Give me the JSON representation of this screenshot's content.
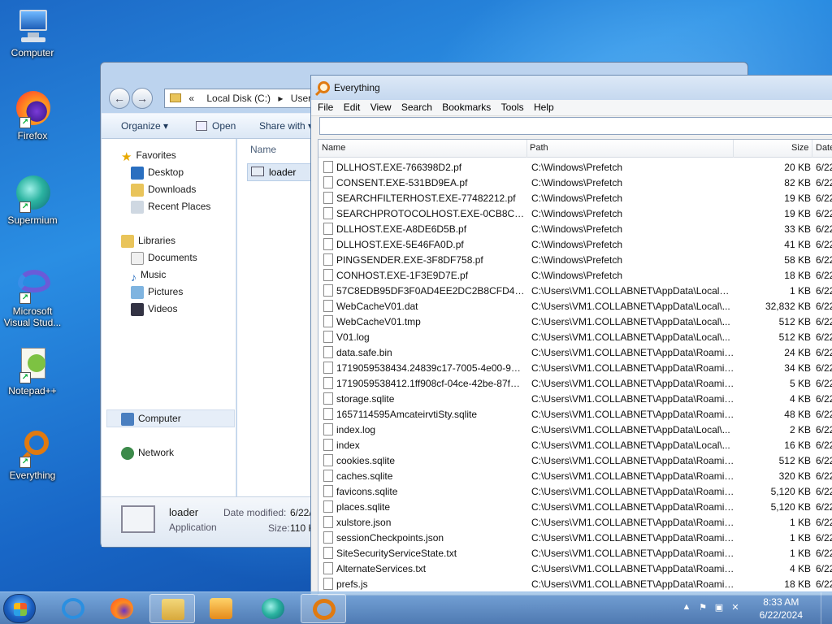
{
  "desktop": {
    "icons": [
      {
        "label": "Computer",
        "icon": "computer-icon"
      },
      {
        "label": "Firefox",
        "icon": "firefox-icon"
      },
      {
        "label": "Supermium",
        "icon": "supermium-icon"
      },
      {
        "label": "Microsoft Visual Studio...",
        "label_line1": "Microsoft",
        "label_line2": "Visual Stud...",
        "icon": "visual-studio-icon"
      },
      {
        "label": "Notepad++",
        "icon": "notepad-plus-plus-icon"
      },
      {
        "label": "Everything",
        "icon": "everything-icon"
      }
    ]
  },
  "explorer": {
    "breadcrumb": [
      "«",
      "Local Disk (C:)",
      "Users"
    ],
    "toolbar": {
      "organize": "Organize ▾",
      "open": "Open",
      "share_with": "Share with ▾"
    },
    "nav": {
      "favorites": "Favorites",
      "desktop": "Desktop",
      "downloads": "Downloads",
      "recent_places": "Recent Places",
      "libraries": "Libraries",
      "documents": "Documents",
      "music": "Music",
      "pictures": "Pictures",
      "videos": "Videos",
      "computer": "Computer",
      "network": "Network"
    },
    "content": {
      "column_name": "Name",
      "file_name": "loader"
    },
    "details": {
      "name": "loader",
      "type": "Application",
      "date_modified_label": "Date modified:",
      "date_modified_value": "6/22/",
      "size_label": "Size:",
      "size_value": "110 K"
    }
  },
  "everything": {
    "title": "Everything",
    "menu": [
      "File",
      "Edit",
      "View",
      "Search",
      "Bookmarks",
      "Tools",
      "Help"
    ],
    "search_value": "",
    "columns": {
      "name": "Name",
      "path": "Path",
      "size": "Size",
      "date": "Date"
    },
    "rows": [
      {
        "name": "DLLHOST.EXE-766398D2.pf",
        "path": "C:\\Windows\\Prefetch",
        "size": "20 KB",
        "date": "6/22"
      },
      {
        "name": "CONSENT.EXE-531BD9EA.pf",
        "path": "C:\\Windows\\Prefetch",
        "size": "82 KB",
        "date": "6/22"
      },
      {
        "name": "SEARCHFILTERHOST.EXE-77482212.pf",
        "path": "C:\\Windows\\Prefetch",
        "size": "19 KB",
        "date": "6/22"
      },
      {
        "name": "SEARCHPROTOCOLHOST.EXE-0CB8CADE...",
        "path": "C:\\Windows\\Prefetch",
        "size": "19 KB",
        "date": "6/22"
      },
      {
        "name": "DLLHOST.EXE-A8DE6D5B.pf",
        "path": "C:\\Windows\\Prefetch",
        "size": "33 KB",
        "date": "6/22"
      },
      {
        "name": "DLLHOST.EXE-5E46FA0D.pf",
        "path": "C:\\Windows\\Prefetch",
        "size": "41 KB",
        "date": "6/22"
      },
      {
        "name": "PINGSENDER.EXE-3F8DF758.pf",
        "path": "C:\\Windows\\Prefetch",
        "size": "58 KB",
        "date": "6/22"
      },
      {
        "name": "CONHOST.EXE-1F3E9D7E.pf",
        "path": "C:\\Windows\\Prefetch",
        "size": "18 KB",
        "date": "6/22"
      },
      {
        "name": "57C8EDB95DF3F0AD4EE2DC2B8CFD4157",
        "path": "C:\\Users\\VM1.COLLABNET\\AppData\\LocalLo...",
        "size": "1 KB",
        "date": "6/22"
      },
      {
        "name": "WebCacheV01.dat",
        "path": "C:\\Users\\VM1.COLLABNET\\AppData\\Local\\...",
        "size": "32,832 KB",
        "date": "6/22"
      },
      {
        "name": "WebCacheV01.tmp",
        "path": "C:\\Users\\VM1.COLLABNET\\AppData\\Local\\...",
        "size": "512 KB",
        "date": "6/22"
      },
      {
        "name": "V01.log",
        "path": "C:\\Users\\VM1.COLLABNET\\AppData\\Local\\...",
        "size": "512 KB",
        "date": "6/22"
      },
      {
        "name": "data.safe.bin",
        "path": "C:\\Users\\VM1.COLLABNET\\AppData\\Roamin...",
        "size": "24 KB",
        "date": "6/22"
      },
      {
        "name": "1719059538434.24839c17-7005-4e00-9185-...",
        "path": "C:\\Users\\VM1.COLLABNET\\AppData\\Roamin...",
        "size": "34 KB",
        "date": "6/22"
      },
      {
        "name": "1719059538412.1ff908cf-04ce-42be-87f4-3...",
        "path": "C:\\Users\\VM1.COLLABNET\\AppData\\Roamin...",
        "size": "5 KB",
        "date": "6/22"
      },
      {
        "name": "storage.sqlite",
        "path": "C:\\Users\\VM1.COLLABNET\\AppData\\Roamin...",
        "size": "4 KB",
        "date": "6/22"
      },
      {
        "name": "1657114595AmcateirvtiSty.sqlite",
        "path": "C:\\Users\\VM1.COLLABNET\\AppData\\Roamin...",
        "size": "48 KB",
        "date": "6/22"
      },
      {
        "name": "index.log",
        "path": "C:\\Users\\VM1.COLLABNET\\AppData\\Local\\...",
        "size": "2 KB",
        "date": "6/22"
      },
      {
        "name": "index",
        "path": "C:\\Users\\VM1.COLLABNET\\AppData\\Local\\...",
        "size": "16 KB",
        "date": "6/22"
      },
      {
        "name": "cookies.sqlite",
        "path": "C:\\Users\\VM1.COLLABNET\\AppData\\Roamin...",
        "size": "512 KB",
        "date": "6/22"
      },
      {
        "name": "caches.sqlite",
        "path": "C:\\Users\\VM1.COLLABNET\\AppData\\Roamin...",
        "size": "320 KB",
        "date": "6/22"
      },
      {
        "name": "favicons.sqlite",
        "path": "C:\\Users\\VM1.COLLABNET\\AppData\\Roamin...",
        "size": "5,120 KB",
        "date": "6/22"
      },
      {
        "name": "places.sqlite",
        "path": "C:\\Users\\VM1.COLLABNET\\AppData\\Roamin...",
        "size": "5,120 KB",
        "date": "6/22"
      },
      {
        "name": "xulstore.json",
        "path": "C:\\Users\\VM1.COLLABNET\\AppData\\Roamin...",
        "size": "1 KB",
        "date": "6/22"
      },
      {
        "name": "sessionCheckpoints.json",
        "path": "C:\\Users\\VM1.COLLABNET\\AppData\\Roamin...",
        "size": "1 KB",
        "date": "6/22"
      },
      {
        "name": "SiteSecurityServiceState.txt",
        "path": "C:\\Users\\VM1.COLLABNET\\AppData\\Roamin...",
        "size": "1 KB",
        "date": "6/22"
      },
      {
        "name": "AlternateServices.txt",
        "path": "C:\\Users\\VM1.COLLABNET\\AppData\\Roamin...",
        "size": "4 KB",
        "date": "6/22"
      },
      {
        "name": "prefs.js",
        "path": "C:\\Users\\VM1.COLLABNET\\AppData\\Roamin...",
        "size": "18 KB",
        "date": "6/22"
      }
    ]
  },
  "taskbar": {
    "items": [
      "internet-explorer-icon",
      "firefox-icon",
      "file-explorer-icon",
      "media-player-icon",
      "supermium-icon",
      "everything-icon"
    ],
    "clock_time": "8:33 AM",
    "clock_date": "6/22/2024"
  }
}
